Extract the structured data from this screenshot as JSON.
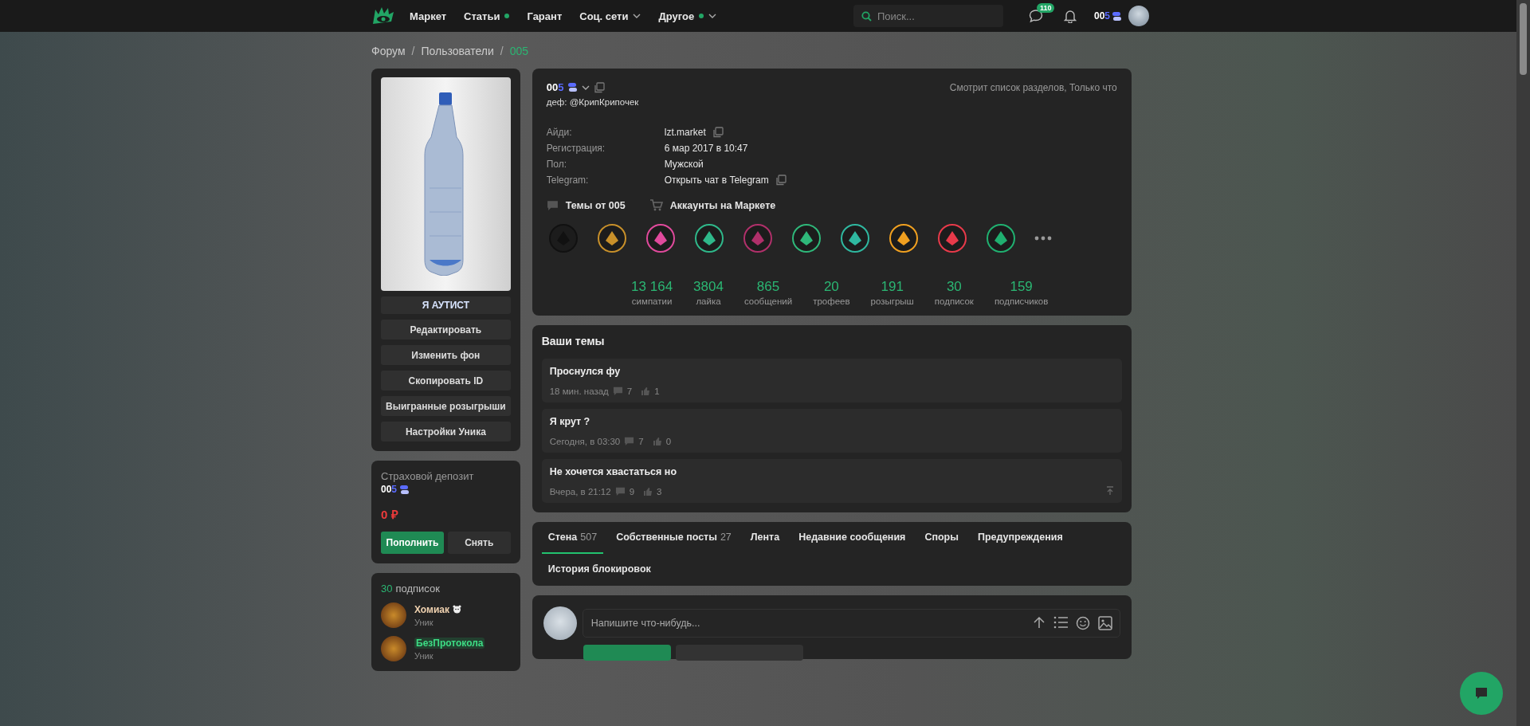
{
  "topbar": {
    "nav": [
      {
        "label": "Маркет",
        "dot": false,
        "dropdown": false
      },
      {
        "label": "Статьи",
        "dot": true,
        "dropdown": false
      },
      {
        "label": "Гарант",
        "dot": false,
        "dropdown": false
      },
      {
        "label": "Соц. сети",
        "dot": false,
        "dropdown": true
      },
      {
        "label": "Другое",
        "dot": true,
        "dropdown": true
      }
    ],
    "search": {
      "placeholder": "Поиск..."
    },
    "chat_count": "110",
    "username": [
      {
        "text": "00",
        "color": "#ffffff"
      },
      {
        "text": "5",
        "color": "#5a6bff"
      }
    ]
  },
  "breadcrumb": {
    "separator": "/",
    "items": [
      {
        "label": "Форум",
        "current": false
      },
      {
        "label": "Пользователи",
        "current": false
      },
      {
        "label": "005",
        "current": true
      }
    ]
  },
  "sidebar": {
    "title": "Я АУТИСТ",
    "buttons": [
      "Редактировать",
      "Изменить фон",
      "Скопировать ID",
      "Выигранные розыгрыши",
      "Настройки Уника"
    ],
    "deposit": {
      "label": "Страховой депозит",
      "username": [
        {
          "text": "00",
          "color": "#ffffff"
        },
        {
          "text": "5",
          "color": "#5a6bff"
        }
      ],
      "amount": "0 ₽",
      "buttons": [
        {
          "label": "Пополнить",
          "kind": "primary"
        },
        {
          "label": "Снять",
          "kind": "secondary"
        }
      ]
    },
    "subscriptions": {
      "count": "30",
      "label": "подписок",
      "items": [
        {
          "name": "Хомиак",
          "role": "Уник",
          "color": "#f0d2b0",
          "badge": true,
          "highlight": false
        },
        {
          "name": "БезПротокола",
          "role": "Уник",
          "color": "#3ddc84",
          "badge": false,
          "highlight": true
        }
      ]
    }
  },
  "profile": {
    "username": [
      {
        "text": "00",
        "color": "#ffffff"
      },
      {
        "text": "5",
        "color": "#5a6bff"
      }
    ],
    "subtitle": "деф: @КрипКрипочек",
    "activity": "Смотрит список разделов, Только что",
    "info": [
      {
        "label": "Айди:",
        "value": "lzt.market",
        "copy": true
      },
      {
        "label": "Регистрация:",
        "value": "6 мар 2017 в 10:47",
        "copy": false
      },
      {
        "label": "Пол:",
        "value": "Мужской",
        "copy": false
      },
      {
        "label": "Telegram:",
        "value": "Открыть чат в Telegram",
        "copy": true
      }
    ],
    "links": [
      {
        "label": "Темы от 005",
        "kind": "topics"
      },
      {
        "label": "Аккаунты на Маркете",
        "kind": "market"
      }
    ],
    "badges": [
      {
        "color": "#111111"
      },
      {
        "color": "#c8902a"
      },
      {
        "color": "#e04a9c"
      },
      {
        "color": "#2fb88a"
      },
      {
        "color": "#b0306a"
      },
      {
        "color": "#2fb87a"
      },
      {
        "color": "#2fb8a0"
      },
      {
        "color": "#f0a020"
      },
      {
        "color": "#e83a4a"
      },
      {
        "color": "#20b070"
      }
    ],
    "stats": [
      {
        "value": "13 164",
        "label": "симпатии"
      },
      {
        "value": "3804",
        "label": "лайка"
      },
      {
        "value": "865",
        "label": "сообщений"
      },
      {
        "value": "20",
        "label": "трофеев"
      },
      {
        "value": "191",
        "label": "розыгрыш"
      },
      {
        "value": "30",
        "label": "подписок"
      },
      {
        "value": "159",
        "label": "подписчиков"
      }
    ]
  },
  "topics": {
    "title": "Ваши темы",
    "items": [
      {
        "title": "Проснулся фу",
        "time": "18 мин. назад",
        "comments": "7",
        "likes": "1"
      },
      {
        "title": "Я крут ?",
        "time": "Сегодня, в 03:30",
        "comments": "7",
        "likes": "0"
      },
      {
        "title": "Не хочется хвастаться но",
        "time": "Вчера, в 21:12",
        "comments": "9",
        "likes": "3"
      }
    ]
  },
  "tabs": [
    {
      "label": "Стена",
      "count": "507",
      "selected": true
    },
    {
      "label": "Собственные посты",
      "count": "27",
      "selected": false
    },
    {
      "label": "Лента",
      "selected": false
    },
    {
      "label": "Недавние сообщения",
      "selected": false
    },
    {
      "label": "Споры",
      "selected": false
    },
    {
      "label": "Предупреждения",
      "selected": false
    },
    {
      "label": "История блокировок",
      "selected": false
    }
  ],
  "composer": {
    "placeholder": "Напишите что-нибудь..."
  }
}
